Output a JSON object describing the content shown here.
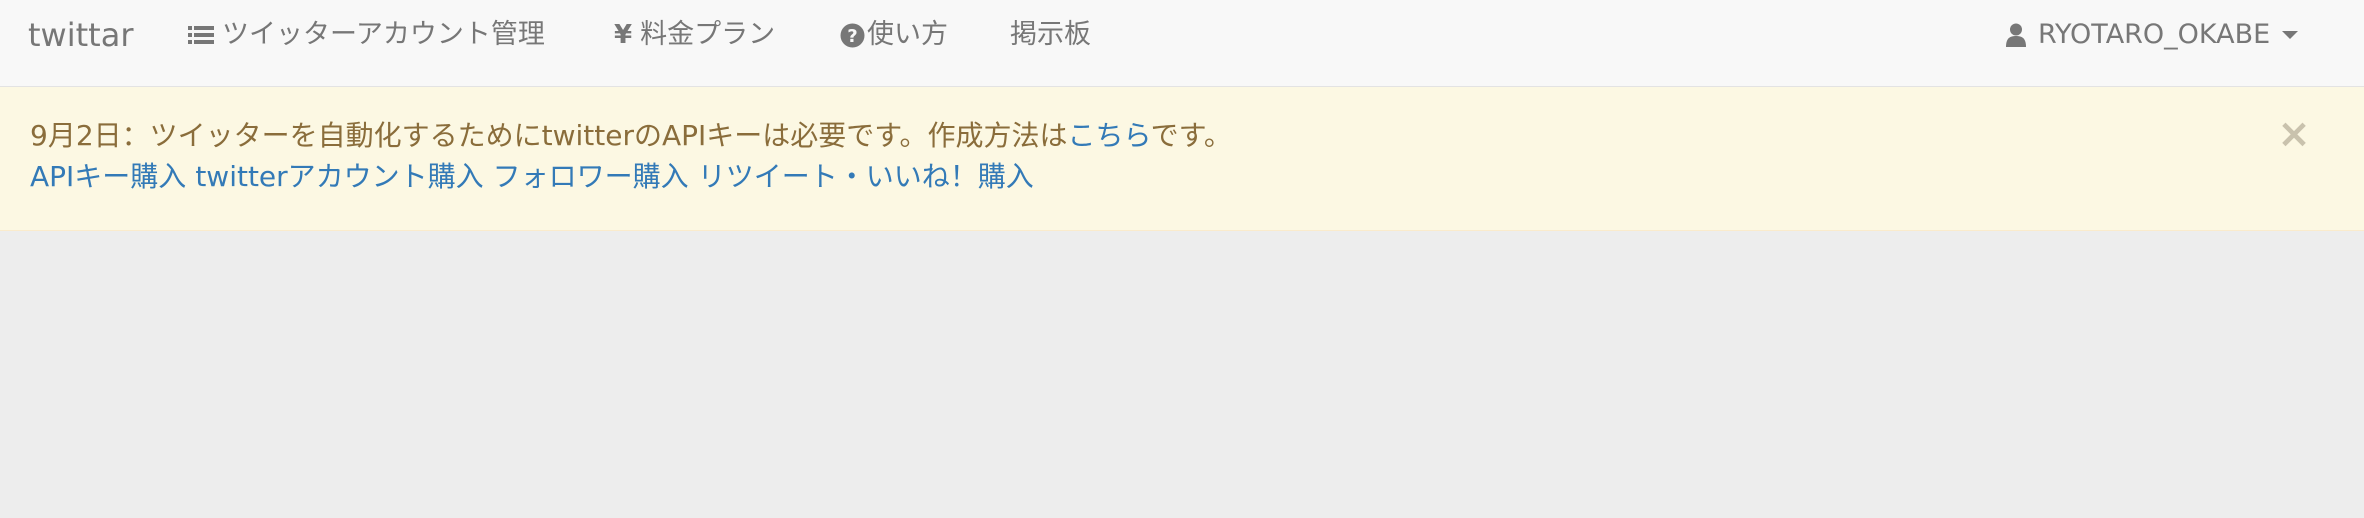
{
  "navbar": {
    "brand": "twittar",
    "items": [
      {
        "label": "ツイッターアカウント管理",
        "icon": "list-icon"
      },
      {
        "label": "料金プラン",
        "icon": "yen-icon"
      },
      {
        "label": "使い方",
        "icon": "question-circle-icon"
      },
      {
        "label": "掲示板",
        "icon": ""
      }
    ],
    "user": {
      "name": "RYOTARO_OKABE",
      "icon": "user-icon"
    }
  },
  "alert": {
    "message_prefix": "9月2日：ツイッターを自動化するためにtwitterのAPIキーは必要です。作成方法は",
    "message_link": "こちら",
    "message_suffix": "です。",
    "links": [
      "APIキー購入",
      "twitterアカウント購入",
      "フォロワー購入",
      "リツイート・いいね！購入"
    ],
    "close_label": "×"
  },
  "colors": {
    "navbar_bg": "#f8f8f8",
    "alert_bg": "#fcf8e3",
    "alert_text": "#8a6d3b",
    "link": "#337ab7",
    "page_bg": "#ededed"
  }
}
